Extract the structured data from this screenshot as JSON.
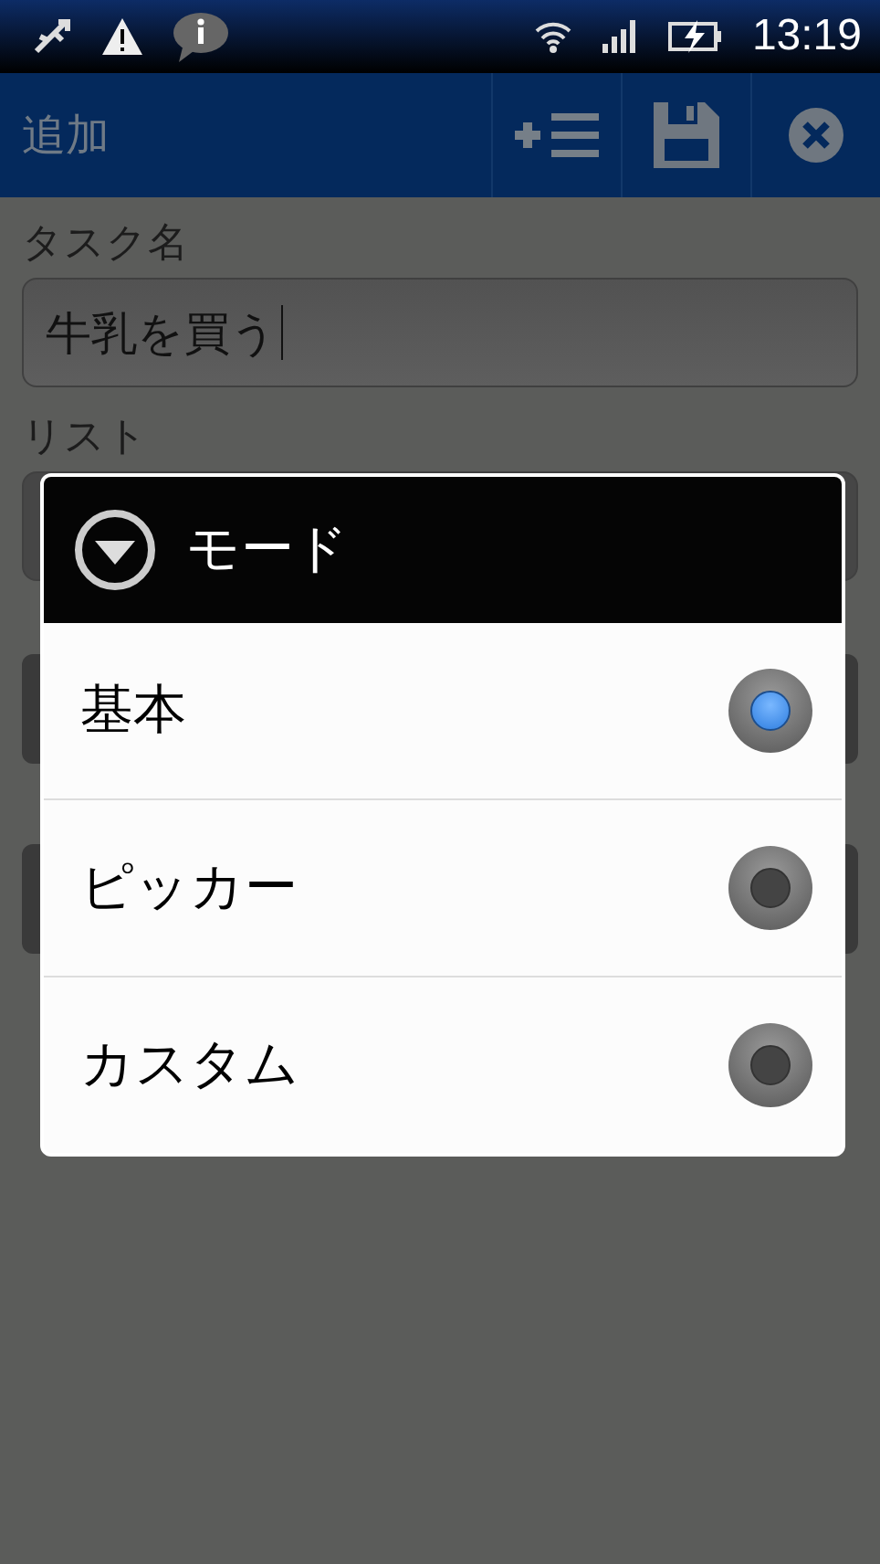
{
  "status_bar": {
    "time": "13:19"
  },
  "action_bar": {
    "title": "追加"
  },
  "form": {
    "fields": [
      {
        "label": "タスク名",
        "value": "牛乳を買う",
        "kind": "text"
      },
      {
        "label": "リスト",
        "kind": "dropdown"
      }
    ]
  },
  "dialog": {
    "title": "モード",
    "options": [
      {
        "label": "基本",
        "selected": true
      },
      {
        "label": "ピッカー",
        "selected": false
      },
      {
        "label": "カスタム",
        "selected": false
      }
    ]
  }
}
